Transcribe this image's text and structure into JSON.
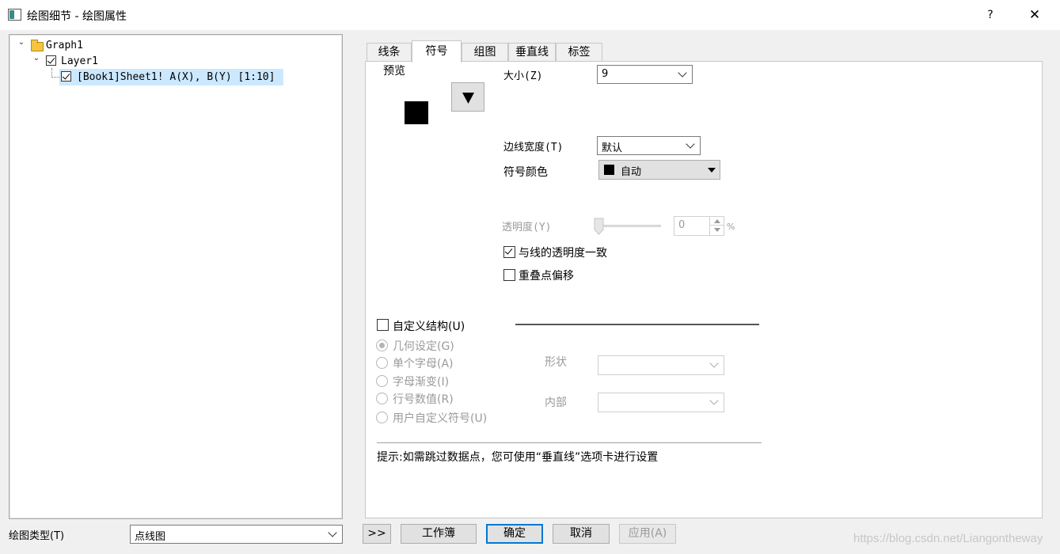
{
  "window": {
    "title": "绘图细节 - 绘图属性",
    "help": "?",
    "close": "✕"
  },
  "tree": {
    "root": "Graph1",
    "layer": "Layer1",
    "plot": "[Book1]Sheet1! A(X), B(Y) [1:10]"
  },
  "plot_type": {
    "label": "绘图类型(T)",
    "value": "点线图"
  },
  "tabs": [
    {
      "label": "线条"
    },
    {
      "label": "符号"
    },
    {
      "label": "组图"
    },
    {
      "label": "垂直线"
    },
    {
      "label": "标签"
    }
  ],
  "active_tab": "符号",
  "symbol": {
    "preview_label": "预览",
    "size_label": "大小(Z)",
    "size_value": "9",
    "edge_width_label": "边线宽度(T)",
    "edge_width_value": "默认",
    "color_label": "符号颜色",
    "color_value": "自动",
    "color_swatch": "#000000",
    "transparency_label": "透明度(Y)",
    "transparency_value": "0",
    "transparency_unit": "%",
    "transparency_level": 0,
    "match_line_transparency_label": "与线的透明度一致",
    "match_line_transparency_checked": true,
    "offset_overlap_label": "重叠点偏移",
    "offset_overlap_checked": false,
    "custom_construction_label": "自定义结构(U)",
    "custom_construction_checked": false,
    "construction_options": [
      {
        "label": "几何设定(G)",
        "selected": true
      },
      {
        "label": "单个字母(A)",
        "selected": false
      },
      {
        "label": "字母渐变(I)",
        "selected": false
      },
      {
        "label": "行号数值(R)",
        "selected": false
      },
      {
        "label": "用户自定义符号(U)",
        "selected": false
      }
    ],
    "shape_label": "形状",
    "interior_label": "内部",
    "hint": "提示:如需跳过数据点，您可使用“垂直线”选项卡进行设置"
  },
  "buttons": {
    "expand": ">>",
    "workbook": "工作簿",
    "ok": "确定",
    "cancel": "取消",
    "apply": "应用(A)"
  },
  "watermark": "https://blog.csdn.net/Liangontheway"
}
